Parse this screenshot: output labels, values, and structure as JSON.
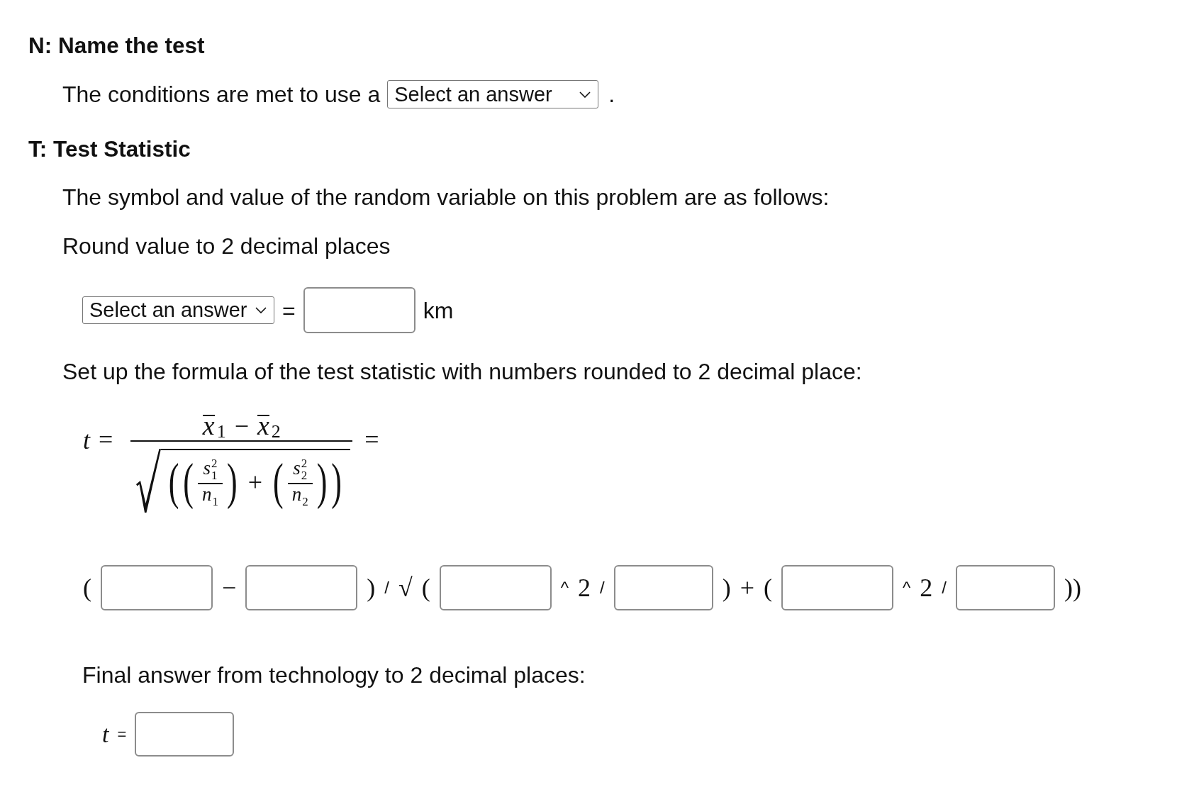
{
  "name_section": {
    "heading": "N: Name the test",
    "sentence_row": [
      {
        "kind": "text",
        "text": "The conditions are met to use a"
      },
      {
        "kind": "dropdown",
        "value": "Select an answer"
      },
      {
        "kind": "text",
        "text": "."
      }
    ]
  },
  "statistic_section": {
    "heading": "T: Test Statistic",
    "intro": "The symbol and value of the random variable on this problem are as follows:",
    "rounding_note": "Round value to 2 decimal places",
    "symbol_row": [
      {
        "kind": "dropdown",
        "value": "Select an answer"
      },
      {
        "kind": "text",
        "text": "="
      },
      {
        "kind": "input"
      },
      {
        "kind": "text",
        "text": "km"
      }
    ],
    "formula_prompt": "Set up the formula of the test statistic with numbers rounded to 2 decimal place:",
    "formula": {
      "variable": "t",
      "equals": "=",
      "numerator": [
        {
          "kind": "term",
          "symbol": "x",
          "overline": true,
          "sub": "1"
        },
        {
          "kind": "operator",
          "text": "−"
        },
        {
          "kind": "term",
          "symbol": "x",
          "overline": true,
          "sub": "2"
        }
      ],
      "radicand": {
        "open": "(",
        "close": ")",
        "items": [
          {
            "kind": "fraction",
            "open": "(",
            "close": ")",
            "top": {
              "symbol": "s",
              "sup": "2",
              "sub": "1"
            },
            "bottom": {
              "symbol": "n",
              "sub": "1"
            }
          },
          {
            "kind": "operator",
            "text": "+"
          },
          {
            "kind": "fraction",
            "open": "(",
            "close": ")",
            "top": {
              "symbol": "s",
              "sup": "2",
              "sub": "2"
            },
            "bottom": {
              "symbol": "n",
              "sub": "2"
            }
          }
        ]
      },
      "trailing_equals": "="
    },
    "expression": [
      {
        "kind": "math",
        "text": "("
      },
      {
        "kind": "input"
      },
      {
        "kind": "math",
        "text": "−"
      },
      {
        "kind": "input"
      },
      {
        "kind": "math",
        "text": ")"
      },
      {
        "kind": "text",
        "text": "/"
      },
      {
        "kind": "math",
        "text": "√"
      },
      {
        "kind": "math",
        "text": "("
      },
      {
        "kind": "input"
      },
      {
        "kind": "text",
        "text": "^"
      },
      {
        "kind": "math",
        "text": "2"
      },
      {
        "kind": "text",
        "text": "/"
      },
      {
        "kind": "shortinput"
      },
      {
        "kind": "math",
        "text": ")"
      },
      {
        "kind": "math",
        "text": "+"
      },
      {
        "kind": "math",
        "text": "("
      },
      {
        "kind": "input"
      },
      {
        "kind": "text",
        "text": "^"
      },
      {
        "kind": "math",
        "text": "2"
      },
      {
        "kind": "text",
        "text": "/"
      },
      {
        "kind": "shortinput"
      },
      {
        "kind": "math",
        "text": "))"
      }
    ],
    "final_prompt": "Final answer from technology to 2 decimal places:",
    "final_row": [
      {
        "kind": "math",
        "text": "t"
      },
      {
        "kind": "text",
        "text": "="
      },
      {
        "kind": "shortinput"
      }
    ]
  }
}
